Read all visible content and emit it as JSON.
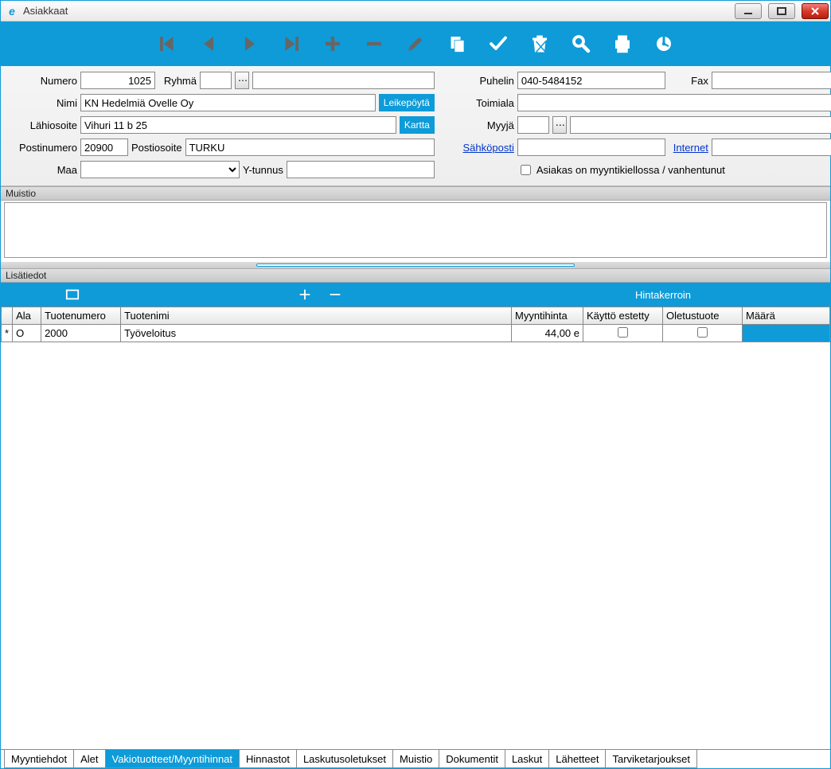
{
  "window": {
    "title": "Asiakkaat"
  },
  "form": {
    "numero_label": "Numero",
    "numero": "1025",
    "ryhma_label": "Ryhmä",
    "ryhma": "",
    "ryhma_text": "",
    "puhelin_label": "Puhelin",
    "puhelin": "040-5484152",
    "fax_label": "Fax",
    "fax": "",
    "nimi_label": "Nimi",
    "nimi": "KN Hedelmiä Ovelle Oy",
    "leikepoyta_btn": "Leikepöytä",
    "toimiala_label": "Toimiala",
    "toimiala": "",
    "lahiosoite_label": "Lähiosoite",
    "lahiosoite": "Vihuri 11 b 25",
    "kartta_btn": "Kartta",
    "myyja_label": "Myyjä",
    "myyja": "",
    "myyja_text": "",
    "postinumero_label": "Postinumero",
    "postinumero": "20900",
    "postiosoite_label": "Postiosoite",
    "postiosoite": "TURKU",
    "sahkoposti_label": "Sähköposti",
    "sahkoposti": "",
    "internet_label": "Internet",
    "internet": "",
    "maa_label": "Maa",
    "maa": "",
    "ytunnus_label": "Y-tunnus",
    "ytunnus": "",
    "myyntikielto_label": "Asiakas on myyntikiellossa / vanhentunut"
  },
  "sections": {
    "muistio": "Muistio",
    "lisatiedot": "Lisätiedot"
  },
  "subtoolbar": {
    "hintakerroin": "Hintakerroin"
  },
  "grid": {
    "cols": {
      "rowmarker": "*",
      "ala": "Ala",
      "tuotenumero": "Tuotenumero",
      "tuotenimi": "Tuotenimi",
      "myyntihinta": "Myyntihinta",
      "kaytto_estetty": "Käyttö estetty",
      "oletustuote": "Oletustuote",
      "maara": "Määrä"
    },
    "rows": [
      {
        "ala": "O",
        "tuotenumero": "2000",
        "tuotenimi": "Työveloitus",
        "myyntihinta": "44,00 e",
        "kaytto_estetty": false,
        "oletustuote": false,
        "maara": ""
      }
    ]
  },
  "tabs": [
    "Myyntiehdot",
    "Alet",
    "Vakiotuotteet/Myyntihinnat",
    "Hinnastot",
    "Laskutusoletukset",
    "Muistio",
    "Dokumentit",
    "Laskut",
    "Lähetteet",
    "Tarviketarjoukset"
  ],
  "active_tab_index": 2
}
